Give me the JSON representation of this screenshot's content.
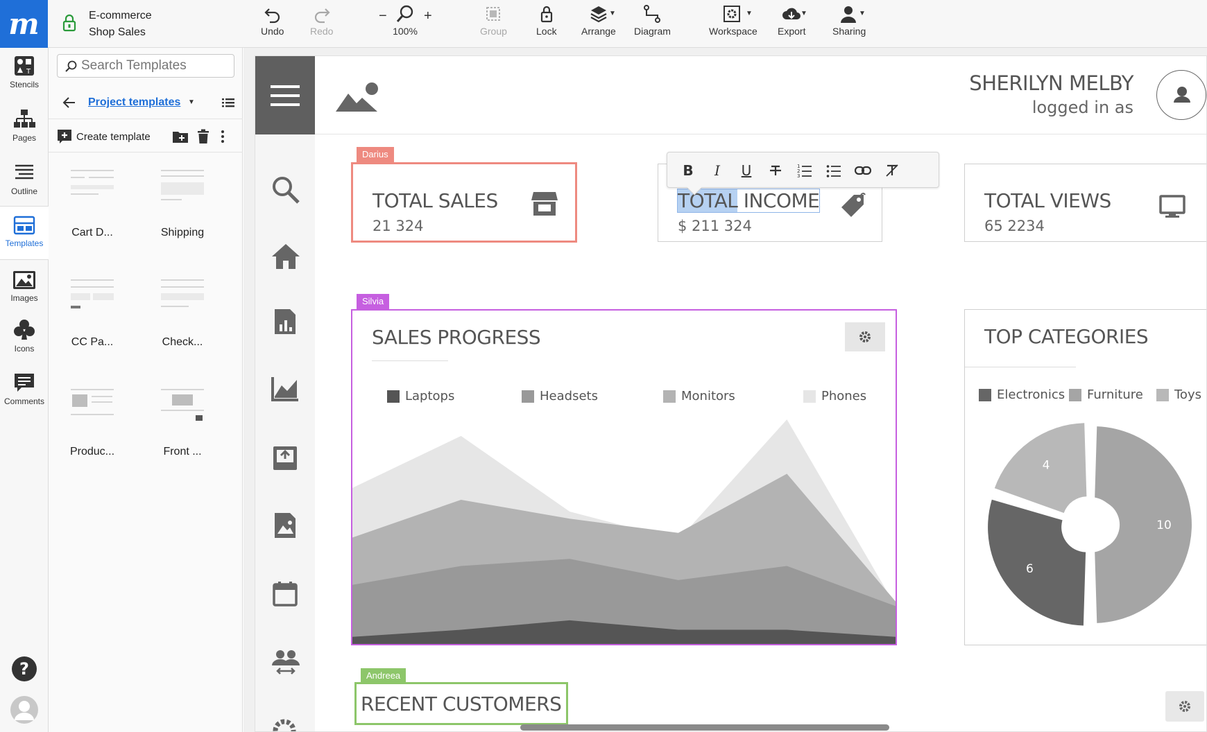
{
  "app": {
    "logo_letter": "m",
    "doc_title_line1": "E-commerce",
    "doc_title_line2": "Shop Sales"
  },
  "toolbar": {
    "undo": "Undo",
    "redo": "Redo",
    "zoom_minus": "−",
    "zoom_plus": "+",
    "zoom_level": "100%",
    "group": "Group",
    "lock": "Lock",
    "arrange": "Arrange",
    "diagram": "Diagram",
    "workspace": "Workspace",
    "export": "Export",
    "sharing": "Sharing"
  },
  "rail": {
    "items": [
      {
        "label": "Stencils",
        "icon": "stencils-icon"
      },
      {
        "label": "Pages",
        "icon": "pages-icon"
      },
      {
        "label": "Outline",
        "icon": "outline-icon"
      },
      {
        "label": "Templates",
        "icon": "templates-icon",
        "active": true
      },
      {
        "label": "Images",
        "icon": "images-icon"
      },
      {
        "label": "Icons",
        "icon": "club-icon"
      },
      {
        "label": "Comments",
        "icon": "comments-icon"
      }
    ],
    "help_label": "?"
  },
  "panel": {
    "search_placeholder": "Search Templates",
    "project_link": "Project templates",
    "create_template": "Create template",
    "templates": [
      "Cart D...",
      "Shipping",
      "CC Pa...",
      "Check...",
      "Produc...",
      "Front ..."
    ]
  },
  "mockup": {
    "user_name": "SHERILYN MELBY",
    "user_sub": "logged in as",
    "cards": [
      {
        "title": "TOTAL SALES",
        "value": "21 324",
        "icon": "store-icon"
      },
      {
        "title_selected": "TOTAL",
        "title_rest": " INCOME",
        "value": "$ 211 324",
        "icon": "price-tag-icon"
      },
      {
        "title": "TOTAL VIEWS",
        "value": "65 2234",
        "icon": "monitor-icon"
      }
    ],
    "collaborators": {
      "darius": "Darius",
      "silvia": "Silvia",
      "andreea": "Andreea"
    },
    "collaborator_colors": {
      "darius": "#ee8a80",
      "silvia": "#c65fe0",
      "andreea": "#8dc66a"
    },
    "sales_progress_title": "SALES PROGRESS",
    "top_categories_title": "TOP CATEGORIES",
    "recent_customers_title": "RECENT CUSTOMERS"
  },
  "chart_data": [
    {
      "type": "area",
      "title": "SALES PROGRESS",
      "x": [
        0,
        1,
        2,
        3,
        4,
        5
      ],
      "ylim": [
        0,
        100
      ],
      "legend": "top",
      "series": [
        {
          "name": "Laptops",
          "color": "#555555",
          "values": [
            3,
            6,
            10,
            6,
            6,
            3
          ]
        },
        {
          "name": "Headsets",
          "color": "#999999",
          "values": [
            25,
            33,
            36,
            27,
            33,
            16
          ]
        },
        {
          "name": "Monitors",
          "color": "#b3b3b3",
          "values": [
            45,
            61,
            53,
            47,
            72,
            18
          ]
        },
        {
          "name": "Phones",
          "color": "#e6e6e6",
          "values": [
            66,
            88,
            56,
            44,
            95,
            16
          ]
        }
      ]
    },
    {
      "type": "pie",
      "title": "TOP CATEGORIES",
      "legend": "top",
      "categories": [
        "Electronics",
        "Furniture",
        "Toys"
      ],
      "values": [
        6,
        10,
        4
      ],
      "colors": [
        "#666666",
        "#a5a5a5",
        "#b8b8b8"
      ],
      "slices": [
        {
          "label": "Furniture",
          "value": 10,
          "color": "#a5a5a5"
        },
        {
          "label": "Electronics",
          "value": 6,
          "color": "#666666"
        },
        {
          "label": "Toys",
          "value": 4,
          "color": "#b8b8b8"
        }
      ]
    }
  ]
}
